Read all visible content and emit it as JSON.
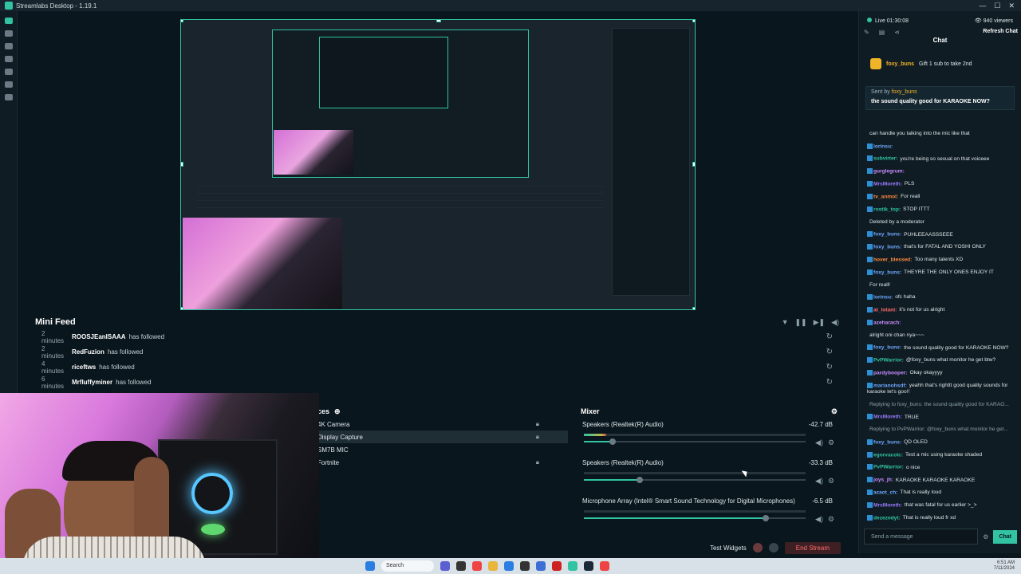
{
  "app": {
    "title": "Streamlabs Desktop - 1.19.1"
  },
  "editor": {},
  "minifeed": {
    "title": "Mini Feed",
    "rows": [
      {
        "time": "2 minutes",
        "user": "ROOSJEanISAAA",
        "action": "has followed"
      },
      {
        "time": "2 minutes",
        "user": "RedFuzion",
        "action": "has followed"
      },
      {
        "time": "4 minutes",
        "user": "riceftws",
        "action": "has followed"
      },
      {
        "time": "6 minutes",
        "user": "Mrfluffyminer",
        "action": "has followed"
      }
    ]
  },
  "sources": {
    "header": "ces",
    "items": [
      "4K Camera",
      "Display Capture",
      "SM7B MIC",
      "Fortnite"
    ]
  },
  "mixer": {
    "title": "Mixer",
    "channels": [
      {
        "name": "Speakers (Realtek(R) Audio)",
        "db": "-42.7 dB",
        "level": 0.1,
        "volume": 0.13
      },
      {
        "name": "Speakers (Realtek(R) Audio)",
        "db": "-33.3 dB",
        "level": 0.0,
        "volume": 0.25
      },
      {
        "name": "Microphone Array (Intel® Smart Sound Technology for Digital Microphones)",
        "db": "-6.5 dB",
        "level": 0.0,
        "volume": 0.82
      }
    ]
  },
  "bottombar": {
    "test_widgets": "Test Widgets",
    "end_stream": "End Stream"
  },
  "chat": {
    "live": "Live 01:30:08",
    "viewers": "940 viewers",
    "refresh": "Refresh Chat",
    "title": "Chat",
    "gift_user": "foxy_buns",
    "gift_text": "Gift 1 sub to take 2nd",
    "pinned_sender": "Sent by",
    "pinned_user": "foxy_buns",
    "pinned_msg": "the sound quality good for KARAOKE NOW?",
    "messages": [
      {
        "user": "",
        "color": "#dfe6ea",
        "text": "can handle you talking into the mic like that"
      },
      {
        "user": "lorinsu:",
        "color": "#6fa8ff",
        "text": ""
      },
      {
        "user": "subvirter:",
        "color": "#31c3a2",
        "text": "you're being so sexual on that voiceee"
      },
      {
        "user": "gurglegrum:",
        "color": "#c98bff",
        "text": ""
      },
      {
        "user": "MrsMoreth:",
        "color": "#9b7bff",
        "text": "PLS"
      },
      {
        "user": "tv_anmol:",
        "color": "#ff8a3d",
        "text": "For reall"
      },
      {
        "user": "rostik_top:",
        "color": "#31c3a2",
        "text": "STOP ITTT"
      },
      {
        "user": "",
        "color": "#dfe6ea",
        "text": "Deleted by a moderator"
      },
      {
        "user": "foxy_buns:",
        "color": "#6fa8ff",
        "text": "PUHLEEAASSSEEE"
      },
      {
        "user": "foxy_buns:",
        "color": "#6fa8ff",
        "text": "that's for FATAL AND YOSHI ONLY"
      },
      {
        "user": "hover_blessed:",
        "color": "#ff8a3d",
        "text": "Too many talents XD"
      },
      {
        "user": "foxy_buns:",
        "color": "#6fa8ff",
        "text": "THEYRE THE ONLY ONES ENJOY IT"
      },
      {
        "user": "",
        "color": "#dfe6ea",
        "text": "For reall!"
      },
      {
        "user": "lorinsu:",
        "color": "#6fa8ff",
        "text": "ofc haha"
      },
      {
        "user": "at_lotani:",
        "color": "#ff6b6b",
        "text": "it's not for us alright"
      },
      {
        "user": "azeharach:",
        "color": "#c98bff",
        "text": ""
      },
      {
        "user": "",
        "color": "#dfe6ea",
        "text": "alright oni chan nya~~~"
      },
      {
        "user": "foxy_buns:",
        "color": "#6fa8ff",
        "text": "the sound quality good for KARAOKE NOW?"
      },
      {
        "user": "PvPWarrior:",
        "color": "#31c3a2",
        "text": "@foxy_buns what monitor he get btw?"
      },
      {
        "user": "pardybooper:",
        "color": "#c98bff",
        "text": "Okay okayyyy"
      },
      {
        "user": "marianohsdf:",
        "color": "#6fa8ff",
        "text": "yeahh that's righttt good quality sounds for karaoke let's goo!!"
      },
      {
        "user": "",
        "color": "#8ea1ab",
        "text": "Replying to foxy_buns: the sound quality good for KARAO..."
      },
      {
        "user": "MrsMoreth:",
        "color": "#9b7bff",
        "text": "TRUE"
      },
      {
        "user": "",
        "color": "#8ea1ab",
        "text": "Replying to PvPWarrior: @foxy_buns what monitor he get..."
      },
      {
        "user": "foxy_buns:",
        "color": "#6fa8ff",
        "text": "QD OLED"
      },
      {
        "user": "egorvacolc:",
        "color": "#31c3a2",
        "text": "Test a mic using karaoke shaded"
      },
      {
        "user": "PvPWarrior:",
        "color": "#31c3a2",
        "text": "o nice"
      },
      {
        "user": "joys_jh:",
        "color": "#c98bff",
        "text": "KARAOKE KARAOKE KARAOKE"
      },
      {
        "user": "azaot_ch:",
        "color": "#6fa8ff",
        "text": "That is really loud"
      },
      {
        "user": "MrsMoreth:",
        "color": "#9b7bff",
        "text": "that was fatal for us earlier >_>"
      },
      {
        "user": "dezezedyt:",
        "color": "#31c3a2",
        "text": "That is really loud fr xd"
      }
    ],
    "send_placeholder": "Send a message",
    "chat_button": "Chat"
  },
  "taskbar": {
    "search": "Search",
    "time": "6:51 AM",
    "date": "7/11/2024"
  },
  "colors": {
    "accent": "#31c3a2",
    "end_stream": "#ff6e6e"
  }
}
